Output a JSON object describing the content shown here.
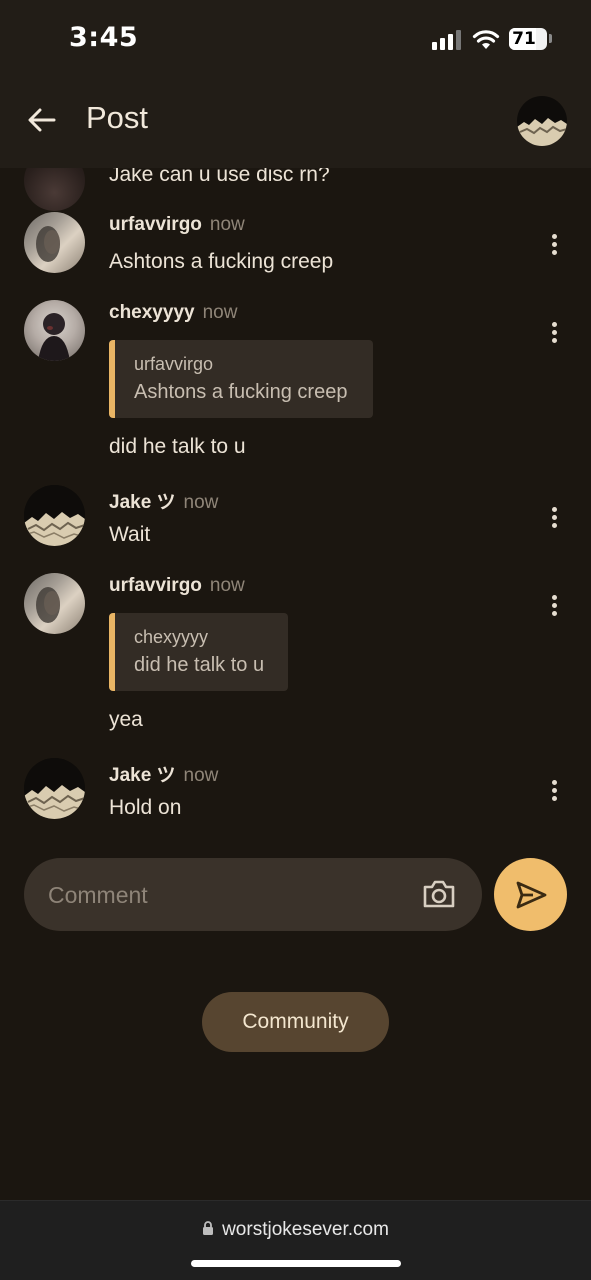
{
  "status_bar": {
    "time": "3:45",
    "battery": "71",
    "battery_level_percent": 71
  },
  "header": {
    "title": "Post"
  },
  "comments": [
    {
      "author": "",
      "timestamp": "",
      "body": "Jake can u use disc rn?",
      "partial": true
    },
    {
      "author": "urfavvirgo",
      "timestamp": "now",
      "body": "Ashtons a fucking creep"
    },
    {
      "author": "chexyyyy",
      "timestamp": "now",
      "quote_author": "urfavvirgo",
      "quote_text": "Ashtons a fucking creep",
      "body": "did he talk to u"
    },
    {
      "author": "Jake ツ",
      "timestamp": "now",
      "body": "Wait"
    },
    {
      "author": "urfavvirgo",
      "timestamp": "now",
      "quote_author": "chexyyyy",
      "quote_text": "did he talk to u",
      "body": "yea"
    },
    {
      "author": "Jake ツ",
      "timestamp": "now",
      "body": "Hold on"
    }
  ],
  "composer": {
    "placeholder": "Comment"
  },
  "community_button_label": "Community",
  "browser": {
    "url": "worstjokesever.com"
  },
  "colors": {
    "background": "#1b1610",
    "accent": "#f0bd6c",
    "quote_bar": "#e9b565",
    "community_button": "#574530"
  },
  "icons": [
    "back-arrow-icon",
    "more-vertical-icon",
    "camera-icon",
    "send-icon",
    "lock-icon"
  ]
}
